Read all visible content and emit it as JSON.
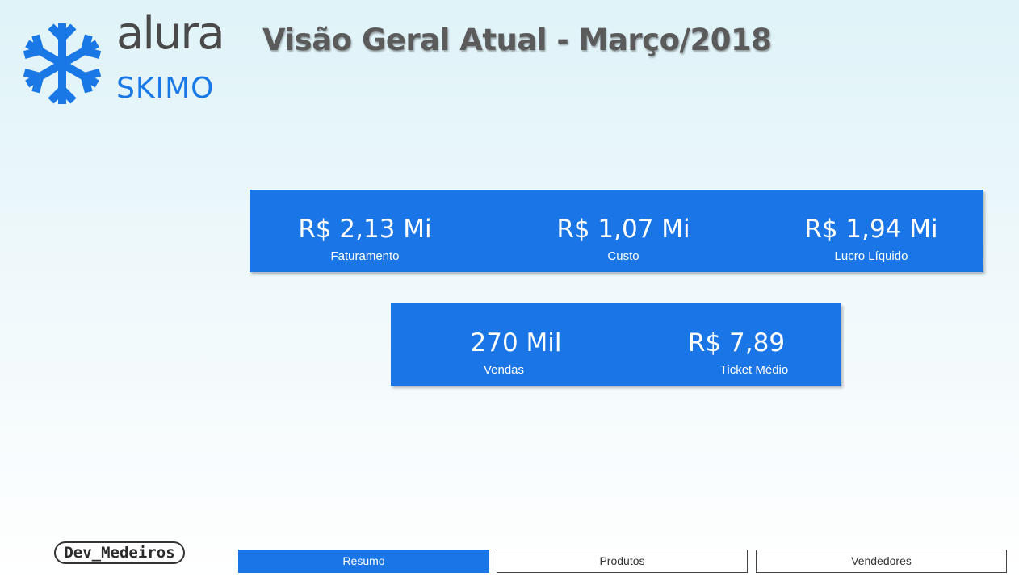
{
  "brand": {
    "name": "alura",
    "product": "SKIMO",
    "logo_icon": "snowflake-icon",
    "color_primary": "#1a75e6",
    "color_text": "#4a4a4a"
  },
  "header": {
    "title": "Visão Geral Atual - Março/2018"
  },
  "kpis_top": [
    {
      "value": "R$ 2,13 Mi",
      "label": "Faturamento"
    },
    {
      "value": "R$ 1,07 Mi",
      "label": "Custo"
    },
    {
      "value": "R$ 1,94 Mi",
      "label": "Lucro Líquido"
    }
  ],
  "kpis_bottom": [
    {
      "value": "270 Mil",
      "label": "Vendas"
    },
    {
      "value": "R$ 7,89",
      "label": "Ticket Médio"
    }
  ],
  "footer": {
    "author_badge": "Dev_Medeiros",
    "nav": [
      {
        "label": "Resumo",
        "active": true
      },
      {
        "label": "Produtos",
        "active": false
      },
      {
        "label": "Vendedores",
        "active": false
      }
    ]
  }
}
